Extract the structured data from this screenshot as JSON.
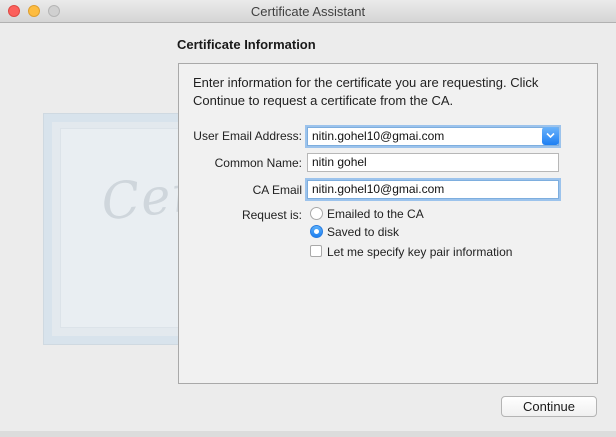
{
  "window": {
    "title": "Certificate Assistant"
  },
  "section": {
    "heading": "Certificate Information",
    "intro": "Enter information for the certificate you are requesting. Click Continue to request a certificate from the CA."
  },
  "form": {
    "user_email_label": "User Email Address:",
    "user_email_value": "nitin.gohel10@gmai.com",
    "common_name_label": "Common Name:",
    "common_name_value": "nitin gohel",
    "ca_email_label": "CA Email",
    "ca_email_value": "nitin.gohel10@gmai.com",
    "request_is_label": "Request is:",
    "options": [
      {
        "label": "Emailed to the CA",
        "selected": false
      },
      {
        "label": "Saved to disk",
        "selected": true
      }
    ],
    "key_pair_label": "Let me specify key pair information",
    "key_pair_checked": false
  },
  "buttons": {
    "continue_label": "Continue"
  },
  "colors": {
    "accent": "#1e7ff0",
    "focus_ring": "#9cc3ec"
  },
  "background_art": {
    "word": "Certificate"
  }
}
